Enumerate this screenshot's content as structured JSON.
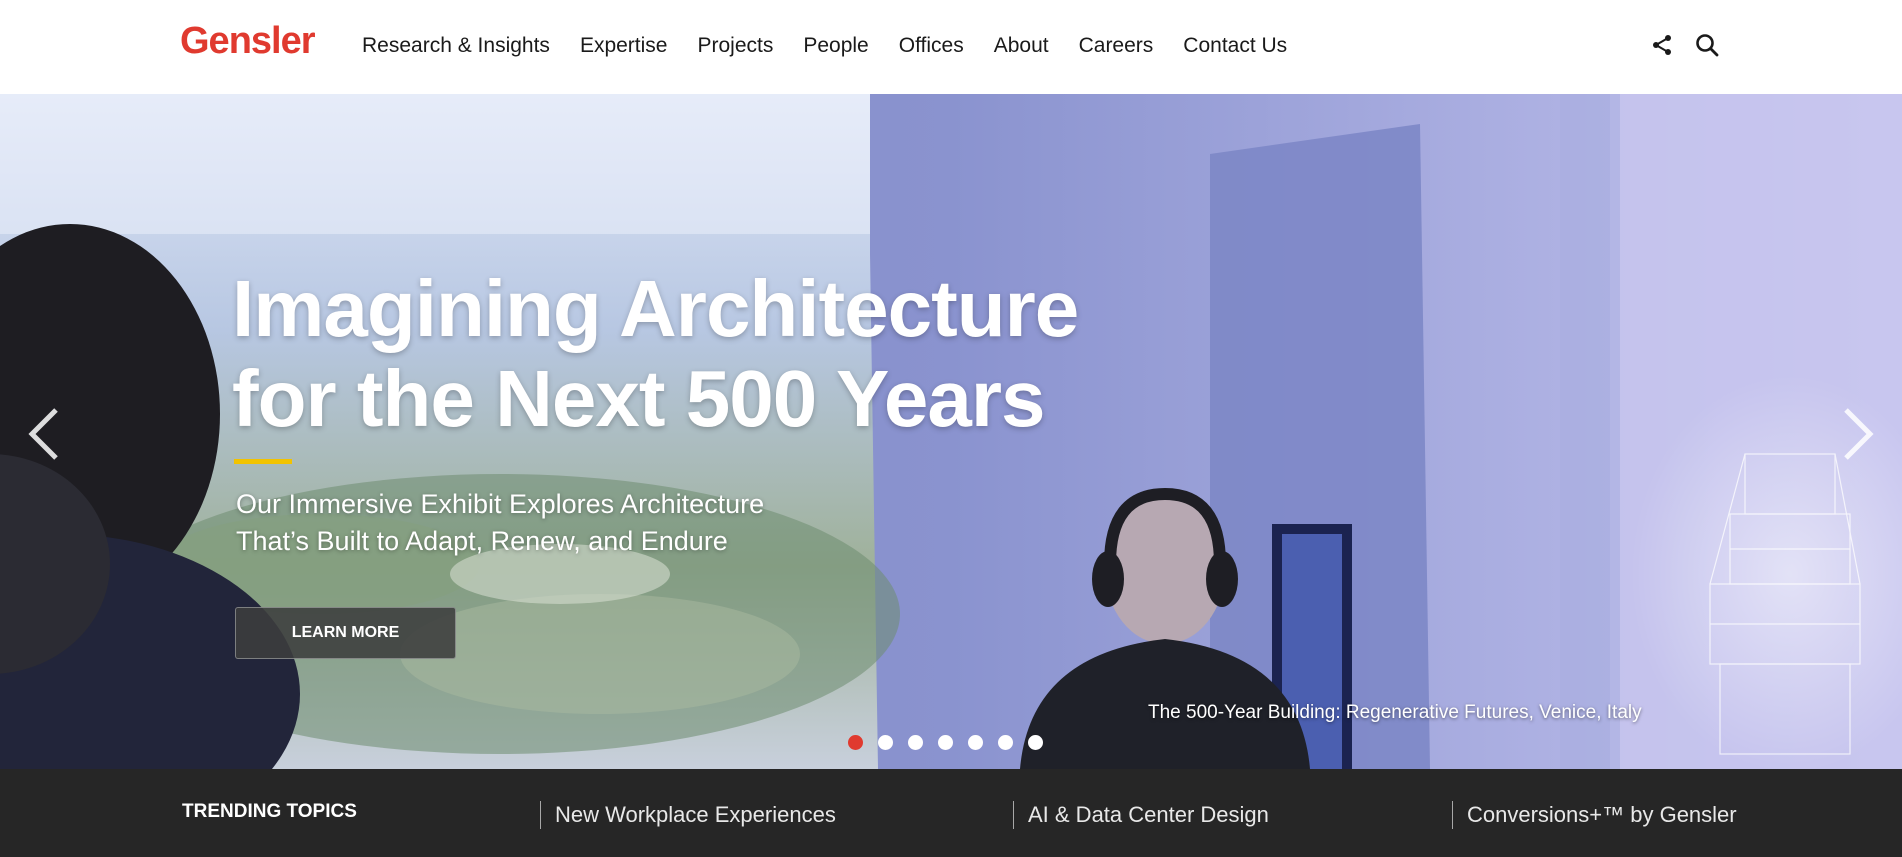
{
  "header": {
    "logo": "Gensler",
    "nav": [
      "Research & Insights",
      "Expertise",
      "Projects",
      "People",
      "Offices",
      "About",
      "Careers",
      "Contact Us"
    ],
    "icons": [
      "share-icon",
      "search-icon"
    ]
  },
  "hero": {
    "title_line1": "Imagining Architecture",
    "title_line2": "for the Next 500 Years",
    "subtitle_line1": "Our Immersive Exhibit Explores Architecture",
    "subtitle_line2": "That’s Built to Adapt, Renew, and Endure",
    "button_label": "LEARN MORE",
    "caption_title": "The 500-Year Building: Regenerative Futures,",
    "caption_place": "Venice, Italy",
    "slide_count": 7,
    "active_slide": 1,
    "colors": {
      "accent": "#f2c300",
      "brand": "#e03a2f"
    }
  },
  "trending": {
    "label": "TRENDING TOPICS",
    "items": [
      "New Workplace Experiences",
      "AI & Data Center Design",
      "Conversions+™ by Gensler"
    ]
  }
}
